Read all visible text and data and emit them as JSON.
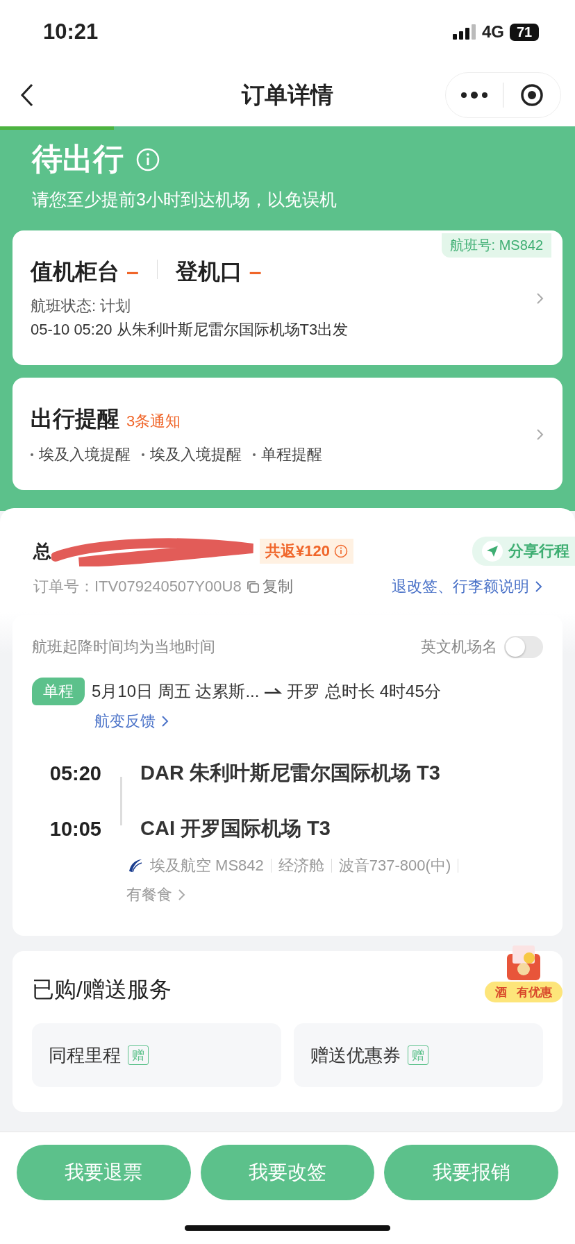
{
  "status_bar": {
    "time": "10:21",
    "network": "4G",
    "battery": "71"
  },
  "nav": {
    "title": "订单详情"
  },
  "trip": {
    "status": "待出行",
    "notice": "请您至少提前3小时到达机场，以免误机"
  },
  "flight_card": {
    "flight_no": "航班号: MS842",
    "checkin_label": "值机柜台",
    "checkin_value": "–",
    "gate_label": "登机口",
    "gate_value": "–",
    "status": "航班状态: 计划",
    "departure": "05-10 05:20 从朱利叶斯尼雷尔国际机场T3出发"
  },
  "reminders": {
    "title": "出行提醒",
    "count": "3条通知",
    "items": [
      "埃及入境提醒",
      "埃及入境提醒",
      "单程提醒"
    ]
  },
  "order": {
    "total_label": "总",
    "rebate": "共返¥120",
    "share": "分享行程",
    "order_no_label": "订单号：",
    "order_no": "ITV079240507Y00U8",
    "copy": "复制",
    "rules_link": "退改签、行李额说明"
  },
  "segment": {
    "note": "航班起降时间均为当地时间",
    "english_names": {
      "label": "英文机场名",
      "on": false
    },
    "tag": "单程",
    "route_from": "5月10日 周五 达累斯...",
    "route_to": "开罗 总时长 4时45分",
    "feedback": "航变反馈",
    "depart": {
      "time": "05:20",
      "airport": "DAR 朱利叶斯尼雷尔国际机场 T3"
    },
    "arrive": {
      "time": "10:05",
      "airport": "CAI 开罗国际机场 T3"
    },
    "details": [
      "埃及航空 MS842",
      "经济舱",
      "波音737-800(中)"
    ],
    "meal": "有餐食"
  },
  "promo": {
    "parts": [
      "酒",
      "有优惠"
    ]
  },
  "services": {
    "title": "已购/赠送服务",
    "items": [
      {
        "name": "同程里程",
        "tag": "赠"
      },
      {
        "name": "赠送优惠券",
        "tag": "赠"
      }
    ]
  },
  "actions": [
    "我要退票",
    "我要改签",
    "我要报销"
  ]
}
